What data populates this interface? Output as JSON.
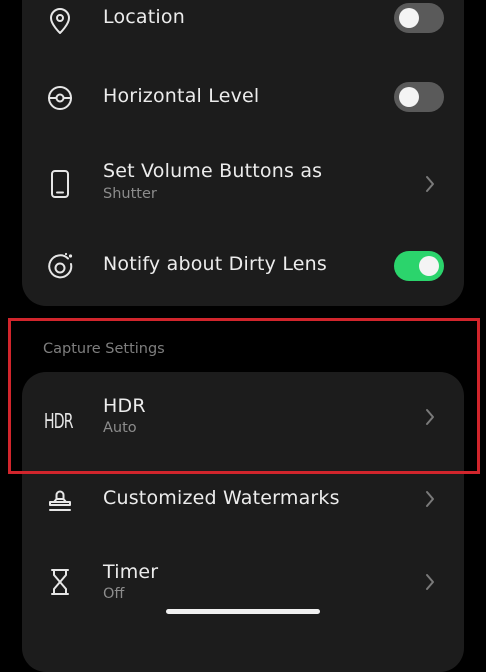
{
  "settings": {
    "location": {
      "label": "Location",
      "enabled": false
    },
    "horizontal_level": {
      "label": "Horizontal Level",
      "enabled": false
    },
    "volume_buttons": {
      "label": "Set Volume Buttons as",
      "value": "Shutter"
    },
    "dirty_lens": {
      "label": "Notify about Dirty Lens",
      "enabled": true
    }
  },
  "capture_settings": {
    "section_label": "Capture Settings",
    "hdr": {
      "label": "HDR",
      "value": "Auto",
      "icon_text": "HDR"
    },
    "watermarks": {
      "label": "Customized Watermarks"
    },
    "timer": {
      "label": "Timer",
      "value": "Off"
    }
  },
  "icons": {
    "location": "location-pin-icon",
    "horizontal_level": "level-icon",
    "volume_buttons": "phone-icon",
    "dirty_lens": "lens-icon",
    "watermarks": "stamp-icon",
    "timer": "hourglass-icon"
  },
  "colors": {
    "background": "#000000",
    "card": "#1c1c1c",
    "toggle_on": "#2bd46c",
    "toggle_off": "#5a5a5a",
    "highlight": "#d1252c"
  }
}
